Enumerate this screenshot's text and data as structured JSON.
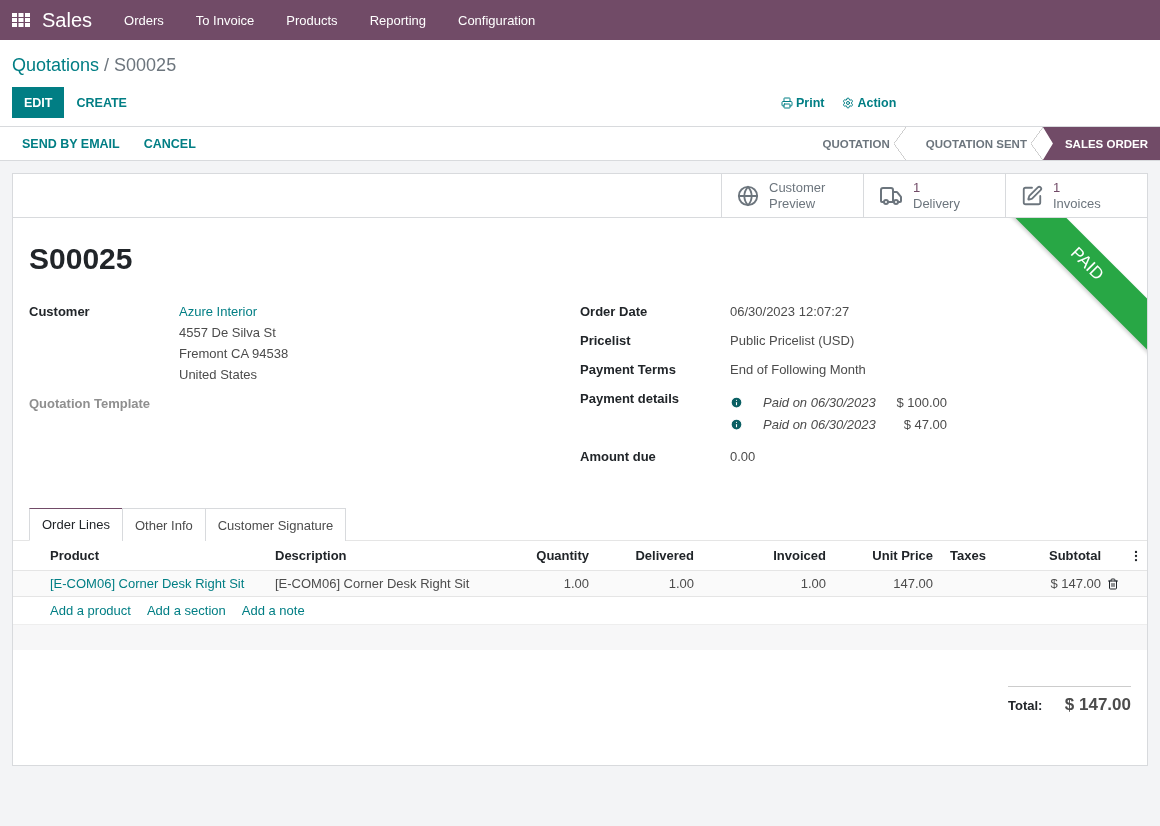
{
  "navbar": {
    "app": "Sales",
    "menu": [
      "Orders",
      "To Invoice",
      "Products",
      "Reporting",
      "Configuration"
    ]
  },
  "breadcrumb": {
    "parent": "Quotations",
    "separator": "/",
    "current": "S00025"
  },
  "toolbar": {
    "buttons": [
      {
        "label": "EDIT",
        "kind": "primary"
      },
      {
        "label": "CREATE",
        "kind": "link"
      }
    ],
    "actions": [
      {
        "label": "Print",
        "kind": "print"
      },
      {
        "label": "Action",
        "kind": "gear"
      }
    ]
  },
  "statusbar": {
    "buttons": [
      "SEND BY EMAIL",
      "CANCEL"
    ],
    "stages": [
      {
        "label": "QUOTATION",
        "selected": false
      },
      {
        "label": "QUOTATION SENT",
        "selected": false
      },
      {
        "label": "SALES ORDER",
        "selected": true
      }
    ]
  },
  "smart_buttons": [
    {
      "kind": "globe",
      "label": "Customer Preview"
    },
    {
      "kind": "truck",
      "count": "1",
      "label": "Delivery"
    },
    {
      "kind": "edit",
      "count": "1",
      "label": "Invoices"
    }
  ],
  "ribbon": "PAID",
  "title": "S00025",
  "fields_left": [
    {
      "kind": "address",
      "label": "Customer",
      "lines": [
        "Azure Interior",
        "4557 De Silva St",
        "Fremont CA 94538",
        "United States"
      ]
    },
    {
      "kind": "empty",
      "label": "Quotation Template"
    }
  ],
  "fields_right": [
    {
      "kind": "text",
      "label": "Order Date",
      "value": "06/30/2023 12:07:27"
    },
    {
      "kind": "text",
      "label": "Pricelist",
      "value": "Public Pricelist (USD)"
    },
    {
      "kind": "text",
      "label": "Payment Terms",
      "value": "End of Following Month"
    },
    {
      "kind": "payments",
      "label": "Payment details",
      "payments": [
        {
          "text": "Paid on 06/30/2023",
          "amount": "$ 100.00"
        },
        {
          "text": "Paid on 06/30/2023",
          "amount": "$ 47.00"
        }
      ]
    },
    {
      "kind": "text",
      "label": "Amount due",
      "value": "0.00"
    }
  ],
  "tabs": [
    {
      "label": "Order Lines",
      "selected": true
    },
    {
      "label": "Other Info",
      "selected": false
    },
    {
      "label": "Customer Signature",
      "selected": false
    }
  ],
  "table": {
    "columns": [
      "Product",
      "Description",
      "Quantity",
      "Delivered",
      "Invoiced",
      "Unit Price",
      "Taxes",
      "Subtotal"
    ],
    "rows": [
      [
        "[E-COM06] Corner Desk Right Sit",
        "[E-COM06] Corner Desk Right Sit",
        "1.00",
        "1.00",
        "1.00",
        "147.00",
        "",
        "$ 147.00"
      ]
    ],
    "add_links": [
      "Add a product",
      "Add a section",
      "Add a note"
    ]
  },
  "total": {
    "label": "Total:",
    "value": "$ 147.00"
  }
}
